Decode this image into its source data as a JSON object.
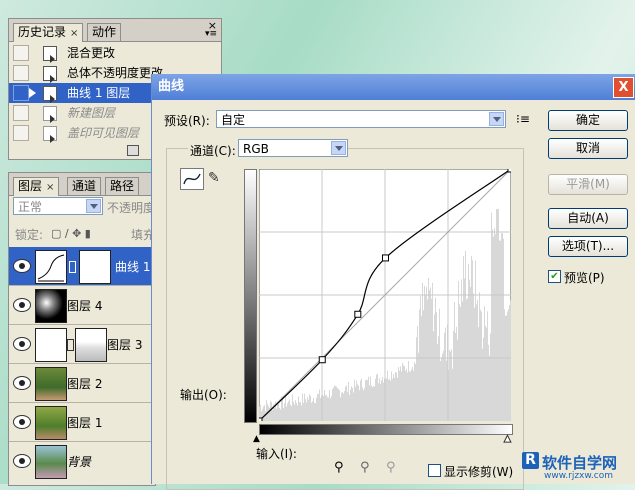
{
  "history_panel": {
    "tabs": [
      {
        "label": "历史记录",
        "close": "×"
      },
      {
        "label": "动作"
      }
    ],
    "close": "×",
    "items": [
      {
        "label": "混合更改",
        "state": "normal"
      },
      {
        "label": "总体不透明度更改",
        "state": "normal"
      },
      {
        "label": "曲线 1 图层",
        "state": "selected"
      },
      {
        "label": "新建图层",
        "state": "undone"
      },
      {
        "label": "盖印可见图层",
        "state": "undone"
      }
    ]
  },
  "layers_panel": {
    "tabs": [
      "图层",
      "通道",
      "路径"
    ],
    "close": "×",
    "blend_mode": "正常",
    "opacity_label": "不透明度",
    "lock_label": "锁定:",
    "fill_label": "填充",
    "layers": [
      {
        "name": "曲线 1",
        "selected": true
      },
      {
        "name": "图层 4",
        "selected": false
      },
      {
        "name": "图层 3",
        "selected": false
      },
      {
        "name": "图层 2",
        "selected": false
      },
      {
        "name": "图层 1",
        "selected": false
      },
      {
        "name": "背景",
        "selected": false
      }
    ]
  },
  "dialog": {
    "title": "曲线",
    "close": "X",
    "preset_label": "预设(R):",
    "preset_value": "自定",
    "channel_label": "通道(C):",
    "channel_value": "RGB",
    "output_label": "输出(O):",
    "input_label": "输入(I):",
    "show_clipping": "显示修剪(W)",
    "buttons": {
      "ok": "确定",
      "cancel": "取消",
      "smooth": "平滑(M)",
      "auto": "自动(A)",
      "options": "选项(T)..."
    },
    "preview": "预览(P)"
  },
  "curve": {
    "points": [
      [
        0,
        0
      ],
      [
        64,
        62
      ],
      [
        100,
        108
      ],
      [
        128,
        165
      ],
      [
        255,
        255
      ]
    ],
    "histogram_color": "#d8d8d8",
    "grid_color": "#c9c9c9"
  },
  "watermark": {
    "text": "软件自学网",
    "url": "www.rjzxw.com",
    "color": "#1b62b8"
  }
}
